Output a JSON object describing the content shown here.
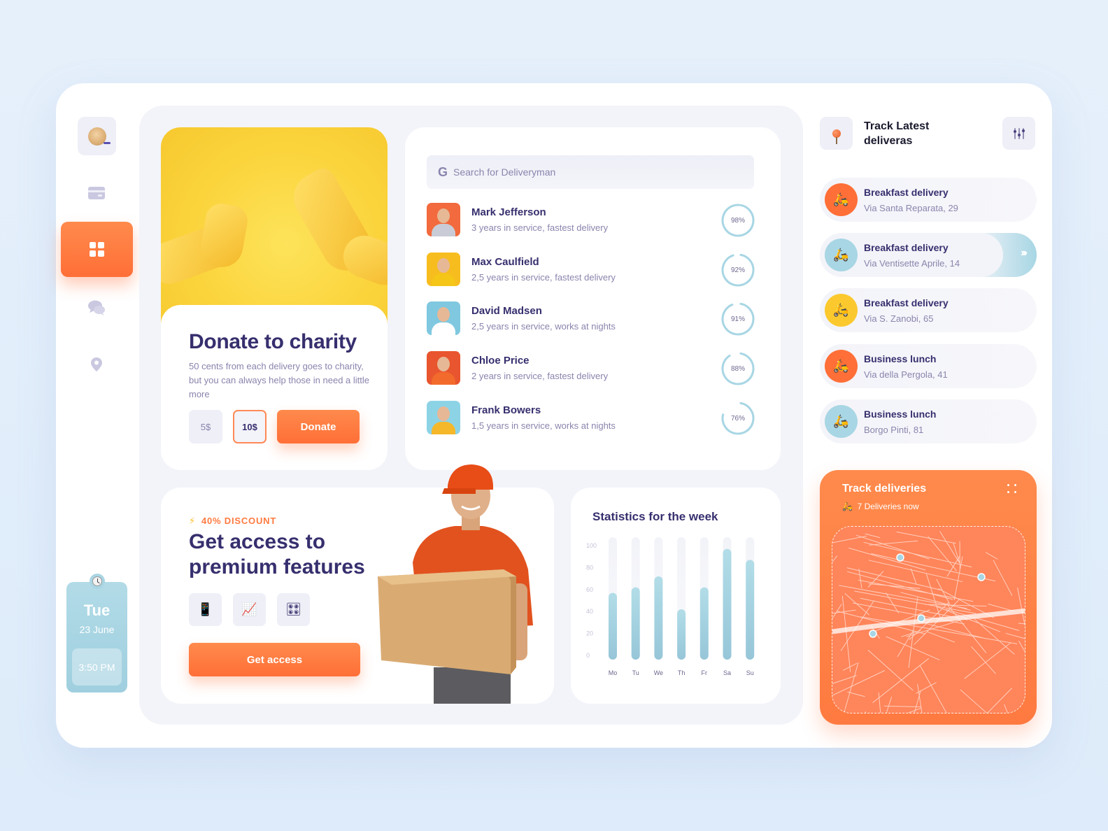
{
  "sidebar": {
    "items": [
      {
        "name": "profile",
        "icon": "avatar"
      },
      {
        "name": "cards",
        "icon": "credit-card-icon"
      },
      {
        "name": "dashboard",
        "icon": "grid-icon",
        "active": true
      },
      {
        "name": "messages",
        "icon": "chat-icon"
      },
      {
        "name": "locations",
        "icon": "location-pin-icon"
      }
    ],
    "date": {
      "day": "Tue",
      "date": "23 June",
      "time": "3:50 PM"
    }
  },
  "donate": {
    "title": "Donate to charity",
    "description": "50 cents from each delivery goes to charity, but you can always help those in need a little more",
    "amounts": [
      "5$",
      "10$"
    ],
    "selected_amount": "10$",
    "button": "Donate"
  },
  "deliverymen": {
    "search_placeholder": "Search for Deliveryman",
    "search_value": "",
    "list": [
      {
        "name": "Mark Jefferson",
        "details": "3 years in service, fastest delivery",
        "rating": 98,
        "rating_label": "98%",
        "bg": "#f26a3d",
        "shirt": "#c9ccd6"
      },
      {
        "name": "Max Caulfield",
        "details": "2,5 years in service, fastest delivery",
        "rating": 92,
        "rating_label": "92%",
        "bg": "#f7bd1f",
        "shirt": "#f5c518"
      },
      {
        "name": "David Madsen",
        "details": "2,5 years in service, works at nights",
        "rating": 91,
        "rating_label": "91%",
        "bg": "#7fc8e0",
        "shirt": "#ffffff"
      },
      {
        "name": "Chloe Price",
        "details": "2 years in service, fastest delivery",
        "rating": 88,
        "rating_label": "88%",
        "bg": "#e8552e",
        "shirt": "#f36b2c"
      },
      {
        "name": "Frank Bowers",
        "details": "1,5 years in service, works at nights",
        "rating": 76,
        "rating_label": "76%",
        "bg": "#8dd3e6",
        "shirt": "#f5b82a"
      }
    ]
  },
  "premium": {
    "badge": "40% DISCOUNT",
    "title": "Get access to premium features",
    "features": [
      {
        "icon": "mobile-phone-icon",
        "glyph": "📱"
      },
      {
        "icon": "chart-increasing-icon",
        "glyph": "📈"
      },
      {
        "icon": "control-knobs-icon",
        "glyph": "🎛"
      }
    ],
    "button": "Get access"
  },
  "chart_data": {
    "type": "bar",
    "title": "Statistics for the week",
    "categories": [
      "Mo",
      "Tu",
      "We",
      "Th",
      "Fr",
      "Sa",
      "Su"
    ],
    "values": [
      57,
      62,
      72,
      42,
      62,
      97,
      87
    ],
    "yticks": [
      0,
      20,
      40,
      60,
      80,
      100
    ],
    "ylim": [
      0,
      100
    ],
    "xlabel": "",
    "ylabel": "",
    "grid": false,
    "color": "#a8d6e4"
  },
  "tracking": {
    "title": "Track Latest deliveras",
    "items": [
      {
        "name": "Breakfast delivery",
        "address": "Via Santa Reparata, 29",
        "color": "#ff6f37",
        "active": false
      },
      {
        "name": "Breakfast delivery",
        "address": "Via Ventisette Aprile, 14",
        "color": "#a8d6e4",
        "active": true
      },
      {
        "name": "Breakfast delivery",
        "address": "Via S. Zanobi, 65",
        "color": "#fbc92e",
        "active": false
      },
      {
        "name": "Business lunch",
        "address": "Via della Pergola, 41",
        "color": "#ff6f37",
        "active": false
      },
      {
        "name": "Business lunch",
        "address": "Borgo Pinti, 81",
        "color": "#a8d6e4",
        "active": false
      }
    ],
    "active_arrow": "›››"
  },
  "map": {
    "title": "Track deliveries",
    "subtitle": "7 Deliveries now"
  },
  "colors": {
    "accent": "#ff7a40",
    "primary_text": "#362f6e",
    "secondary_text": "#8a84ad",
    "light_blue": "#a8d6e4",
    "yellow": "#fbd43c"
  }
}
